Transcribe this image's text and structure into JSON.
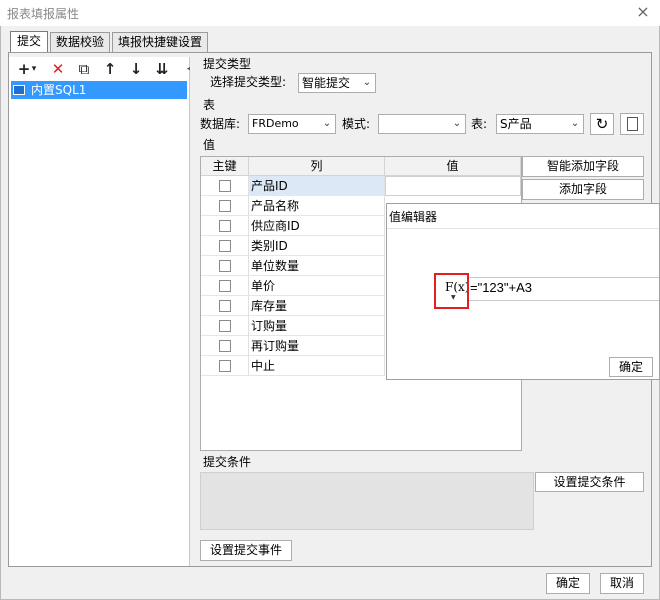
{
  "window": {
    "title": "报表填报属性",
    "close_glyph": "×"
  },
  "tabs": [
    {
      "label": "提交",
      "active": true
    },
    {
      "label": "数据校验",
      "active": false
    },
    {
      "label": "填报快捷键设置",
      "active": false
    }
  ],
  "left_toolbar": {
    "add_glyph": "+",
    "add_dropdown_glyph": "▾",
    "delete_glyph": "✕",
    "copy_glyph": "⧉",
    "up_glyph": "↑",
    "down_glyph": "↓",
    "sort_glyph": "⇊",
    "collapse_glyph": "◂"
  },
  "tree": {
    "items": [
      {
        "label": "内置SQL1",
        "selected": true
      }
    ]
  },
  "submit_type": {
    "section": "提交类型",
    "label": "选择提交类型:",
    "value": "智能提交"
  },
  "table_section": {
    "section": "表",
    "db_label": "数据库:",
    "db_value": "FRDemo",
    "schema_label": "模式:",
    "schema_value": "",
    "table_label": "表:",
    "table_value": "S产品"
  },
  "value_section": {
    "section": "值",
    "columns": [
      "主键",
      "列",
      "值"
    ],
    "rows": [
      {
        "column": "产品ID",
        "selected": true
      },
      {
        "column": "产品名称"
      },
      {
        "column": "供应商ID"
      },
      {
        "column": "类别ID"
      },
      {
        "column": "单位数量"
      },
      {
        "column": "单价"
      },
      {
        "column": "库存量"
      },
      {
        "column": "订购量"
      },
      {
        "column": "再订购量"
      },
      {
        "column": "中止"
      }
    ],
    "smart_add_button": "智能添加字段",
    "add_button": "添加字段"
  },
  "submit_condition": {
    "section": "提交条件",
    "button": "设置提交条件"
  },
  "submit_event_button": "设置提交事件",
  "value_editor": {
    "title": "值编辑器",
    "formula_icon": "F(x)",
    "formula_value": "=\"123\"+A3",
    "ok_button": "确定"
  },
  "footer": {
    "ok": "确定",
    "cancel": "取消"
  },
  "colors": {
    "selection": "#3399ff",
    "highlight_box": "#e02020",
    "delete_icon": "#e02020"
  }
}
